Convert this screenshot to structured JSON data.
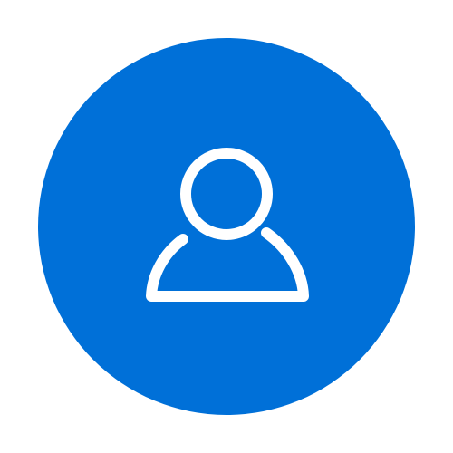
{
  "avatar": {
    "icon": "user-icon",
    "background_color": "#0070d8",
    "icon_color": "#ffffff",
    "page_background": "#ffffff"
  }
}
